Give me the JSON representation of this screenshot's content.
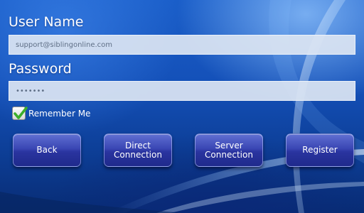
{
  "form": {
    "username_label": "User Name",
    "username_value": "support@siblingonline.com",
    "password_label": "Password",
    "password_value": "•••••••",
    "remember_label": "Remember Me",
    "remember_checked": true
  },
  "buttons": {
    "back": "Back",
    "direct_connection": "Direct\nConnection",
    "server_connection": "Server\nConnection",
    "register": "Register"
  },
  "icons": {
    "checkbox_check": "check-icon"
  },
  "colors": {
    "background": "#1450b8",
    "button": "#3a46b4",
    "check": "#3cae2a",
    "field": "#dae4f2"
  }
}
